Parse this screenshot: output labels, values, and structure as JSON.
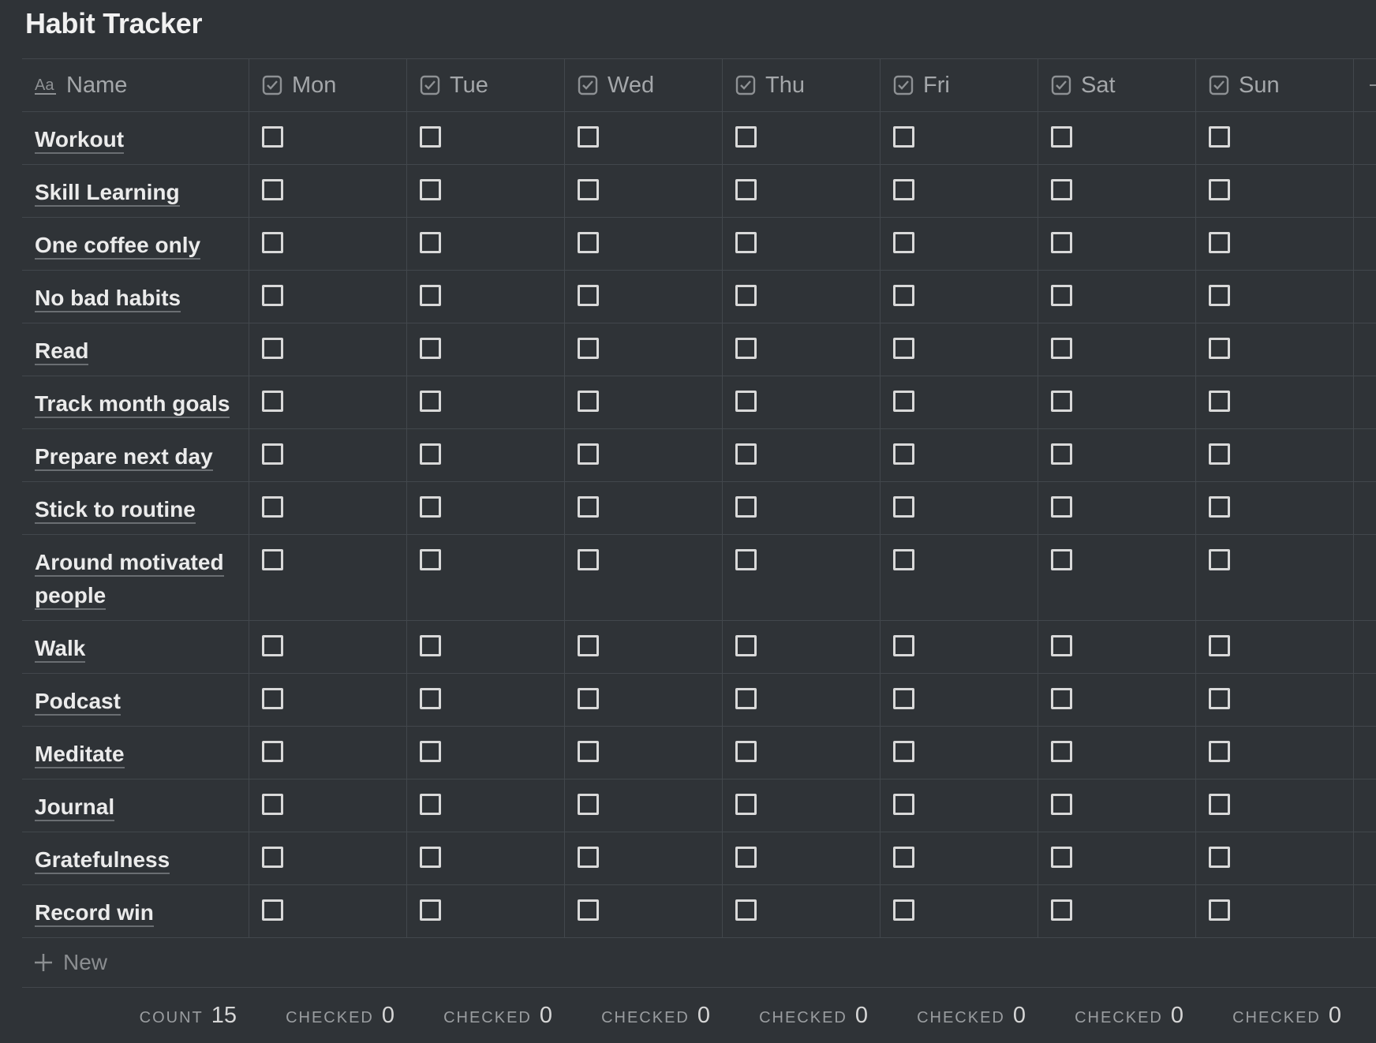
{
  "title": "Habit Tracker",
  "columns": {
    "name": "Name",
    "days": [
      "Mon",
      "Tue",
      "Wed",
      "Thu",
      "Fri",
      "Sat",
      "Sun"
    ]
  },
  "habits": [
    {
      "name": "Workout",
      "checked": [
        false,
        false,
        false,
        false,
        false,
        false,
        false
      ]
    },
    {
      "name": "Skill Learning",
      "checked": [
        false,
        false,
        false,
        false,
        false,
        false,
        false
      ]
    },
    {
      "name": "One coffee only",
      "checked": [
        false,
        false,
        false,
        false,
        false,
        false,
        false
      ]
    },
    {
      "name": "No bad habits",
      "checked": [
        false,
        false,
        false,
        false,
        false,
        false,
        false
      ]
    },
    {
      "name": "Read",
      "checked": [
        false,
        false,
        false,
        false,
        false,
        false,
        false
      ]
    },
    {
      "name": "Track month goals",
      "checked": [
        false,
        false,
        false,
        false,
        false,
        false,
        false
      ]
    },
    {
      "name": "Prepare next day",
      "checked": [
        false,
        false,
        false,
        false,
        false,
        false,
        false
      ]
    },
    {
      "name": "Stick to routine",
      "checked": [
        false,
        false,
        false,
        false,
        false,
        false,
        false
      ]
    },
    {
      "name": "Around motivated people",
      "checked": [
        false,
        false,
        false,
        false,
        false,
        false,
        false
      ]
    },
    {
      "name": "Walk",
      "checked": [
        false,
        false,
        false,
        false,
        false,
        false,
        false
      ]
    },
    {
      "name": "Podcast",
      "checked": [
        false,
        false,
        false,
        false,
        false,
        false,
        false
      ]
    },
    {
      "name": "Meditate",
      "checked": [
        false,
        false,
        false,
        false,
        false,
        false,
        false
      ]
    },
    {
      "name": "Journal",
      "checked": [
        false,
        false,
        false,
        false,
        false,
        false,
        false
      ]
    },
    {
      "name": "Gratefulness",
      "checked": [
        false,
        false,
        false,
        false,
        false,
        false,
        false
      ]
    },
    {
      "name": "Record win",
      "checked": [
        false,
        false,
        false,
        false,
        false,
        false,
        false
      ]
    }
  ],
  "new_label": "New",
  "footer": {
    "count_label": "COUNT",
    "count_value": "15",
    "checked_label": "CHECKED",
    "checked_values": [
      "0",
      "0",
      "0",
      "0",
      "0",
      "0",
      "0"
    ]
  },
  "icons": {
    "name_column": "text-property-icon",
    "day_column": "checkbox-property-icon",
    "add_column": "plus-icon",
    "new_row": "plus-icon"
  },
  "colors": {
    "background": "#2f3337",
    "grid": "#42474c",
    "text": "#ebebeb",
    "muted": "#a4a7aa"
  }
}
